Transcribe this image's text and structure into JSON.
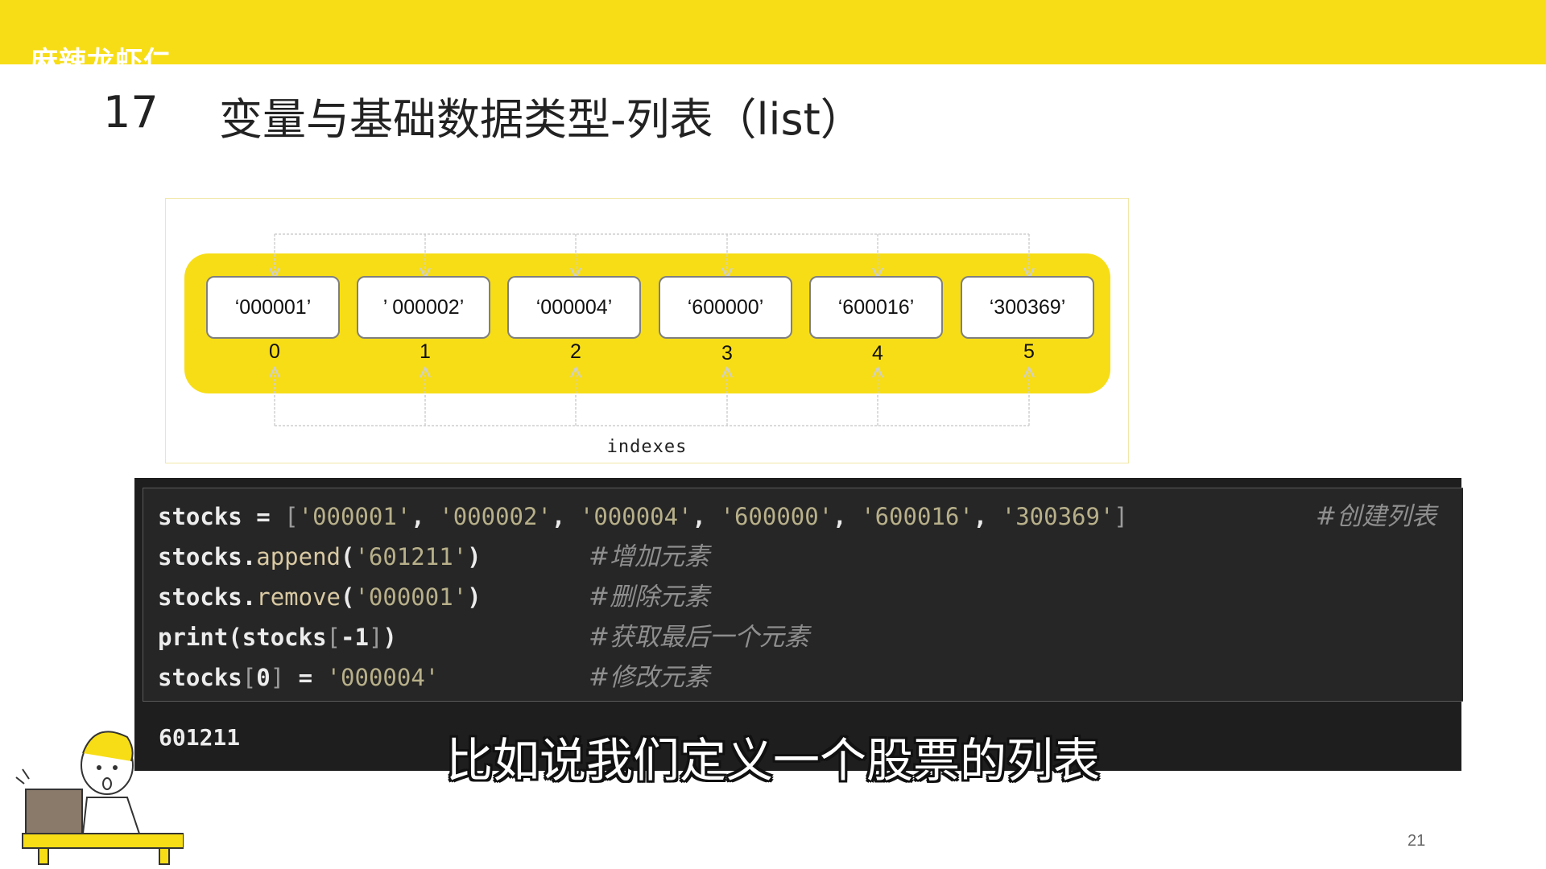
{
  "header": {
    "brand_text": "麻辣龙虾仁",
    "slide_number": "17",
    "title": "变量与基础数据类型-列表（list）",
    "accent_color": "#f7dd16"
  },
  "diagram": {
    "cells": [
      {
        "value": "‘000001’",
        "index": "0"
      },
      {
        "value": "’ 000002’",
        "index": "1"
      },
      {
        "value": "‘000004’",
        "index": "2"
      },
      {
        "value": "‘600000’",
        "index": "3"
      },
      {
        "value": "‘600016’",
        "index": "4"
      },
      {
        "value": "‘300369’",
        "index": "5"
      }
    ],
    "indexes_label": "indexes"
  },
  "code": {
    "lines": [
      {
        "code": "stocks = ['000001', '000002', '000004', '600000', '600016', '300369']",
        "comment": "#创建列表"
      },
      {
        "code": "stocks.append('601211')",
        "comment": "#增加元素"
      },
      {
        "code": "stocks.remove('000001')",
        "comment": "#删除元素"
      },
      {
        "code": "print(stocks[-1])",
        "comment": "#获取最后一个元素"
      },
      {
        "code": "stocks[0] = '000004'",
        "comment": "#修改元素"
      }
    ],
    "output": "601211"
  },
  "subtitle": "比如说我们定义一个股票的列表",
  "page_number": "21"
}
